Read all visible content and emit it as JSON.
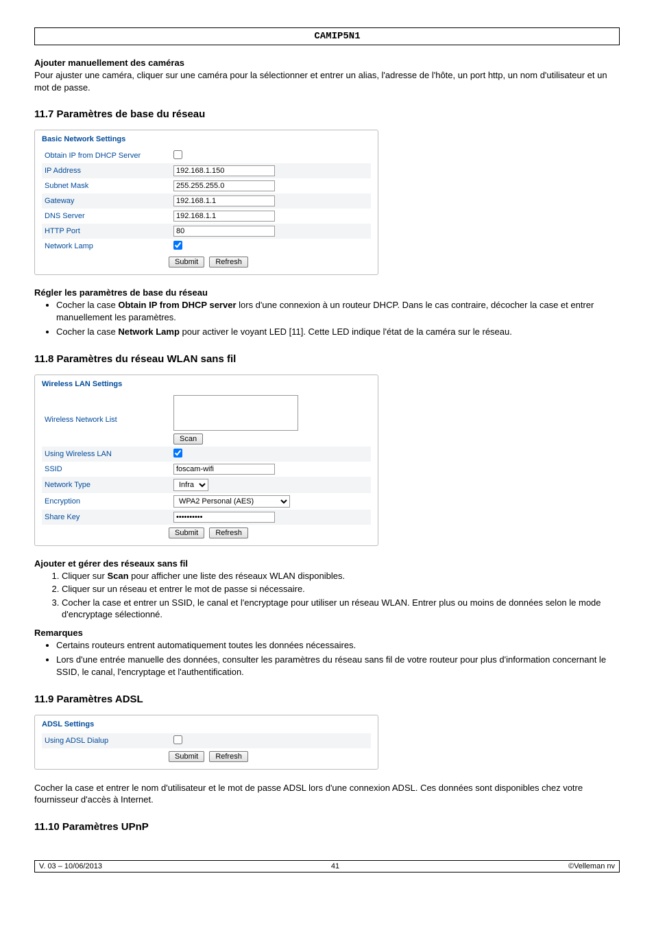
{
  "header": {
    "title": "CAMIP5N1"
  },
  "s_add": {
    "title": "Ajouter manuellement des caméras",
    "text": "Pour ajuster une caméra, cliquer sur une caméra pour la sélectionner et entrer un alias, l'adresse de l'hôte, un port http, un nom d'utilisateur et un mot de passe."
  },
  "s117": {
    "title": "11.7   Paramètres de base du réseau",
    "panel_title": "Basic Network Settings",
    "rows": {
      "dhcp": "Obtain IP from DHCP Server",
      "ip": "IP Address",
      "ip_v": "192.168.1.150",
      "mask": "Subnet Mask",
      "mask_v": "255.255.255.0",
      "gw": "Gateway",
      "gw_v": "192.168.1.1",
      "dns": "DNS Server",
      "dns_v": "192.168.1.1",
      "http": "HTTP Port",
      "http_v": "80",
      "lamp": "Network Lamp"
    },
    "submit": "Submit",
    "refresh": "Refresh",
    "sub_title": "Régler les paramètres de base du réseau",
    "b1a": "Cocher la case ",
    "b1b": "Obtain IP from DHCP server",
    "b1c": " lors d'une connexion à un routeur DHCP. Dans le cas contraire, décocher la case et entrer manuellement les paramètres.",
    "b2a": "Cocher la case ",
    "b2b": "Network Lamp",
    "b2c": " pour activer le voyant LED [11]. Cette LED indique l'état de la caméra sur le réseau."
  },
  "s118": {
    "title": "11.8   Paramètres du réseau WLAN sans fil",
    "panel_title": "Wireless LAN Settings",
    "rows": {
      "list": "Wireless Network List",
      "scan": "Scan",
      "using": "Using Wireless LAN",
      "ssid": "SSID",
      "ssid_v": "foscam-wifi",
      "ntype": "Network Type",
      "ntype_v": "Infra",
      "enc": "Encryption",
      "enc_v": "WPA2 Personal (AES)",
      "key": "Share Key",
      "key_v": "••••••••••"
    },
    "submit": "Submit",
    "refresh": "Refresh",
    "sub_title": "Ajouter et gérer des réseaux sans fil",
    "o1a": "Cliquer sur ",
    "o1b": "Scan",
    "o1c": " pour afficher une liste des réseaux WLAN disponibles.",
    "o2": "Cliquer sur un réseau et entrer le mot de passe si nécessaire.",
    "o3": "Cocher la case et entrer un SSID, le canal et l'encryptage pour utiliser un réseau WLAN. Entrer plus ou moins de données selon le mode d'encryptage sélectionné.",
    "rem_title": "Remarques",
    "rb1": "Certains routeurs entrent automatiquement toutes les données nécessaires.",
    "rb2": "Lors d'une entrée manuelle des données, consulter les paramètres du réseau sans fil de votre routeur pour plus d'information concernant le SSID, le canal, l'encryptage et l'authentification."
  },
  "s119": {
    "title": "11.9   Paramètres ADSL",
    "panel_title": "ADSL Settings",
    "row": "Using ADSL Dialup",
    "submit": "Submit",
    "refresh": "Refresh",
    "p1": "Cocher la case et entrer le nom d'utilisateur et le mot de passe ADSL lors d'une connexion ADSL. Ces données sont disponibles chez votre fournisseur d'accès à Internet."
  },
  "s1110": {
    "title": "11.10 Paramètres UPnP"
  },
  "footer": {
    "left": "V. 03 – 10/06/2013",
    "center": "41",
    "right": "©Velleman nv"
  }
}
